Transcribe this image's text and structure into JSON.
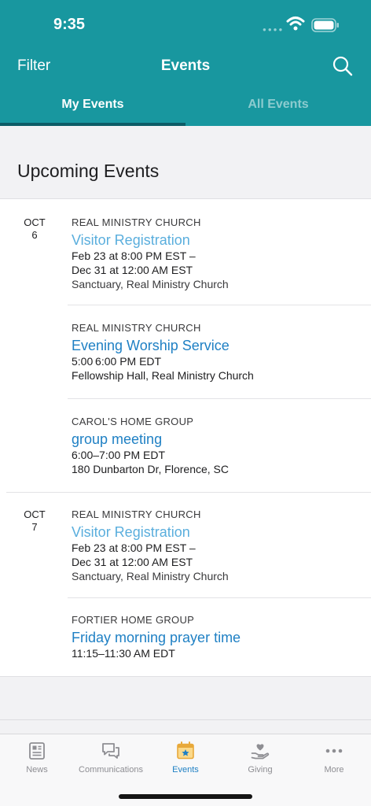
{
  "status_bar": {
    "time": "9:35"
  },
  "nav": {
    "filter_label": "Filter",
    "title": "Events"
  },
  "tabs": [
    {
      "label": "My Events",
      "active": true
    },
    {
      "label": "All Events",
      "active": false
    }
  ],
  "section_title": "Upcoming Events",
  "dates": [
    {
      "month": "OCT",
      "day": "6"
    },
    {
      "month": "OCT",
      "day": "7"
    }
  ],
  "events": [
    {
      "org": "REAL MINISTRY CHURCH",
      "title": "Visitor Registration",
      "time1": "Feb 23 at 8:00 PM EST –",
      "time2": "Dec 31 at 12:00 AM EST",
      "location": "Sanctuary, Real Ministry Church"
    },
    {
      "org": "REAL MINISTRY CHURCH",
      "title": "Evening Worship Service",
      "time1": "5:00 6:00 PM EDT",
      "location": "Fellowship Hall, Real Ministry Church"
    },
    {
      "org": "CAROL'S HOME GROUP",
      "title": "group meeting",
      "time1": "6:00–7:00 PM EDT",
      "location": "180 Dunbarton Dr, Florence, SC"
    },
    {
      "org": "REAL MINISTRY CHURCH",
      "title": "Visitor Registration",
      "time1": "Feb 23 at 8:00 PM EST –",
      "time2": "Dec 31 at 12:00 AM EST",
      "location": "Sanctuary, Real Ministry Church"
    },
    {
      "org": "FORTIER HOME GROUP",
      "title": "Friday morning prayer time",
      "time1": "11:15–11:30 AM EDT"
    }
  ],
  "tabbar": [
    {
      "label": "News",
      "icon": "news-icon"
    },
    {
      "label": "Communications",
      "icon": "chat-bubbles-icon"
    },
    {
      "label": "Events",
      "icon": "calendar-star-icon",
      "active": true
    },
    {
      "label": "Giving",
      "icon": "hand-heart-icon"
    },
    {
      "label": "More",
      "icon": "more-dots-icon"
    }
  ],
  "colors": {
    "header": "#18979f",
    "tab_underline": "#0c5c66",
    "link_light": "#5aaedd",
    "link_dark": "#1f80c4"
  }
}
